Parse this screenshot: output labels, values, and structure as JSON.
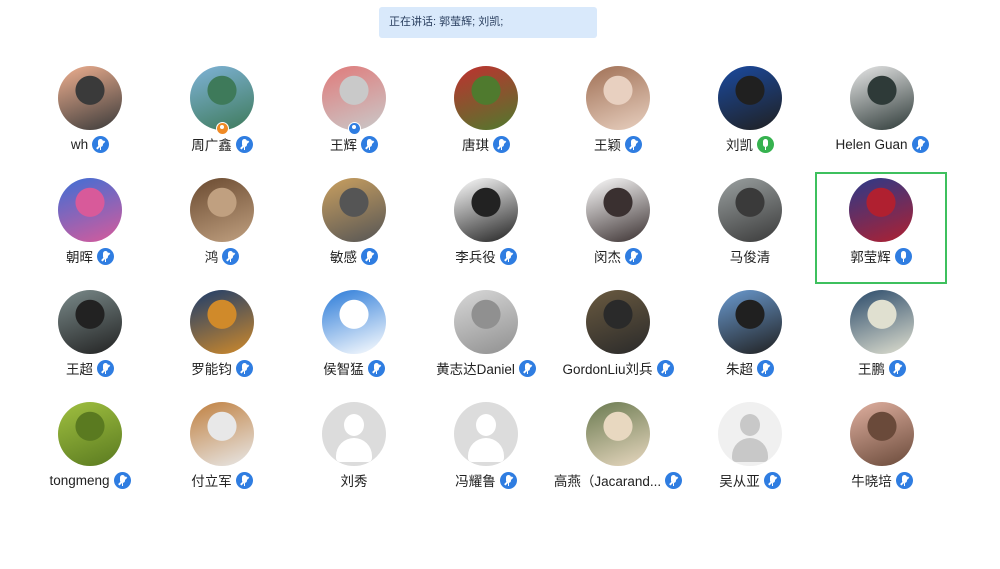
{
  "speaking": {
    "text": "正在讲话: 郭莹辉; 刘凯;"
  },
  "participants": [
    {
      "name": "wh",
      "mic": "muted",
      "avatar": "photo",
      "colors": [
        "#f0b090",
        "#3a3a3a"
      ]
    },
    {
      "name": "周广鑫",
      "mic": "muted",
      "avatar": "photo",
      "colors": [
        "#7fb3d8",
        "#3e7a5a"
      ],
      "badge": "host-orange"
    },
    {
      "name": "王辉",
      "mic": "muted",
      "avatar": "photo",
      "colors": [
        "#e07a7a",
        "#c9c9c9"
      ],
      "badge": "cohost-blue"
    },
    {
      "name": "唐琪",
      "mic": "muted",
      "avatar": "photo",
      "colors": [
        "#c0302f",
        "#4f7a2e"
      ]
    },
    {
      "name": "王颖",
      "mic": "muted",
      "avatar": "photo",
      "colors": [
        "#a07055",
        "#e8d0c0"
      ]
    },
    {
      "name": "刘凯",
      "mic": "active-green",
      "avatar": "photo",
      "colors": [
        "#1a4aa0",
        "#202020"
      ]
    },
    {
      "name": "Helen Guan",
      "mic": "muted",
      "avatar": "photo",
      "colors": [
        "#e8e8e8",
        "#2e3a38"
      ]
    },
    {
      "name": "朝晖",
      "mic": "muted",
      "avatar": "photo",
      "colors": [
        "#3d6fd6",
        "#d85a9a"
      ]
    },
    {
      "name": "鸿",
      "mic": "muted",
      "avatar": "photo",
      "colors": [
        "#6a4a30",
        "#c0a080"
      ]
    },
    {
      "name": "敏感",
      "mic": "muted",
      "avatar": "photo",
      "colors": [
        "#caa060",
        "#555"
      ]
    },
    {
      "name": "李兵役",
      "mic": "muted",
      "avatar": "photo",
      "colors": [
        "#ffffff",
        "#222"
      ]
    },
    {
      "name": "闵杰",
      "mic": "muted",
      "avatar": "photo",
      "colors": [
        "#ffffff",
        "#3a3030"
      ]
    },
    {
      "name": "马俊清",
      "mic": "none",
      "avatar": "photo",
      "colors": [
        "#9aa0a0",
        "#3a3a3a"
      ]
    },
    {
      "name": "郭莹辉",
      "mic": "active-blue",
      "avatar": "photo",
      "colors": [
        "#2a3a8a",
        "#b02030"
      ],
      "active": true
    },
    {
      "name": "王超",
      "mic": "muted",
      "avatar": "photo",
      "colors": [
        "#7a8a8a",
        "#222"
      ]
    },
    {
      "name": "罗能钧",
      "mic": "muted",
      "avatar": "photo",
      "colors": [
        "#1c3c6c",
        "#d08a2a"
      ]
    },
    {
      "name": "侯智猛",
      "mic": "muted",
      "avatar": "photo",
      "colors": [
        "#2a7ad8",
        "#ffffff"
      ]
    },
    {
      "name": "黄志达Daniel",
      "mic": "muted",
      "avatar": "photo",
      "colors": [
        "#d8d8d8",
        "#909090"
      ]
    },
    {
      "name": "GordonLiu刘兵",
      "mic": "muted",
      "avatar": "photo",
      "colors": [
        "#6a5a40",
        "#2a2a2a"
      ]
    },
    {
      "name": "朱超",
      "mic": "muted",
      "avatar": "photo",
      "colors": [
        "#6a9ad0",
        "#202020"
      ]
    },
    {
      "name": "王鹏",
      "mic": "muted",
      "avatar": "photo",
      "colors": [
        "#2a4a6a",
        "#e0e0d0"
      ]
    },
    {
      "name": "tongmeng",
      "mic": "muted",
      "avatar": "photo",
      "colors": [
        "#a0c040",
        "#5a7a20"
      ]
    },
    {
      "name": "付立军",
      "mic": "muted",
      "avatar": "photo",
      "colors": [
        "#c08040",
        "#e8e8e8"
      ]
    },
    {
      "name": "刘秀",
      "mic": "none",
      "avatar": "default"
    },
    {
      "name": "冯耀鲁",
      "mic": "muted",
      "avatar": "default"
    },
    {
      "name": "高燕（Jacarand...",
      "mic": "muted",
      "avatar": "photo",
      "colors": [
        "#6a7a50",
        "#e8d8c0"
      ]
    },
    {
      "name": "吴从亚",
      "mic": "muted",
      "avatar": "default-light"
    },
    {
      "name": "牛晓培",
      "mic": "muted",
      "avatar": "photo",
      "colors": [
        "#e0b0a0",
        "#6a4a3a"
      ]
    }
  ]
}
